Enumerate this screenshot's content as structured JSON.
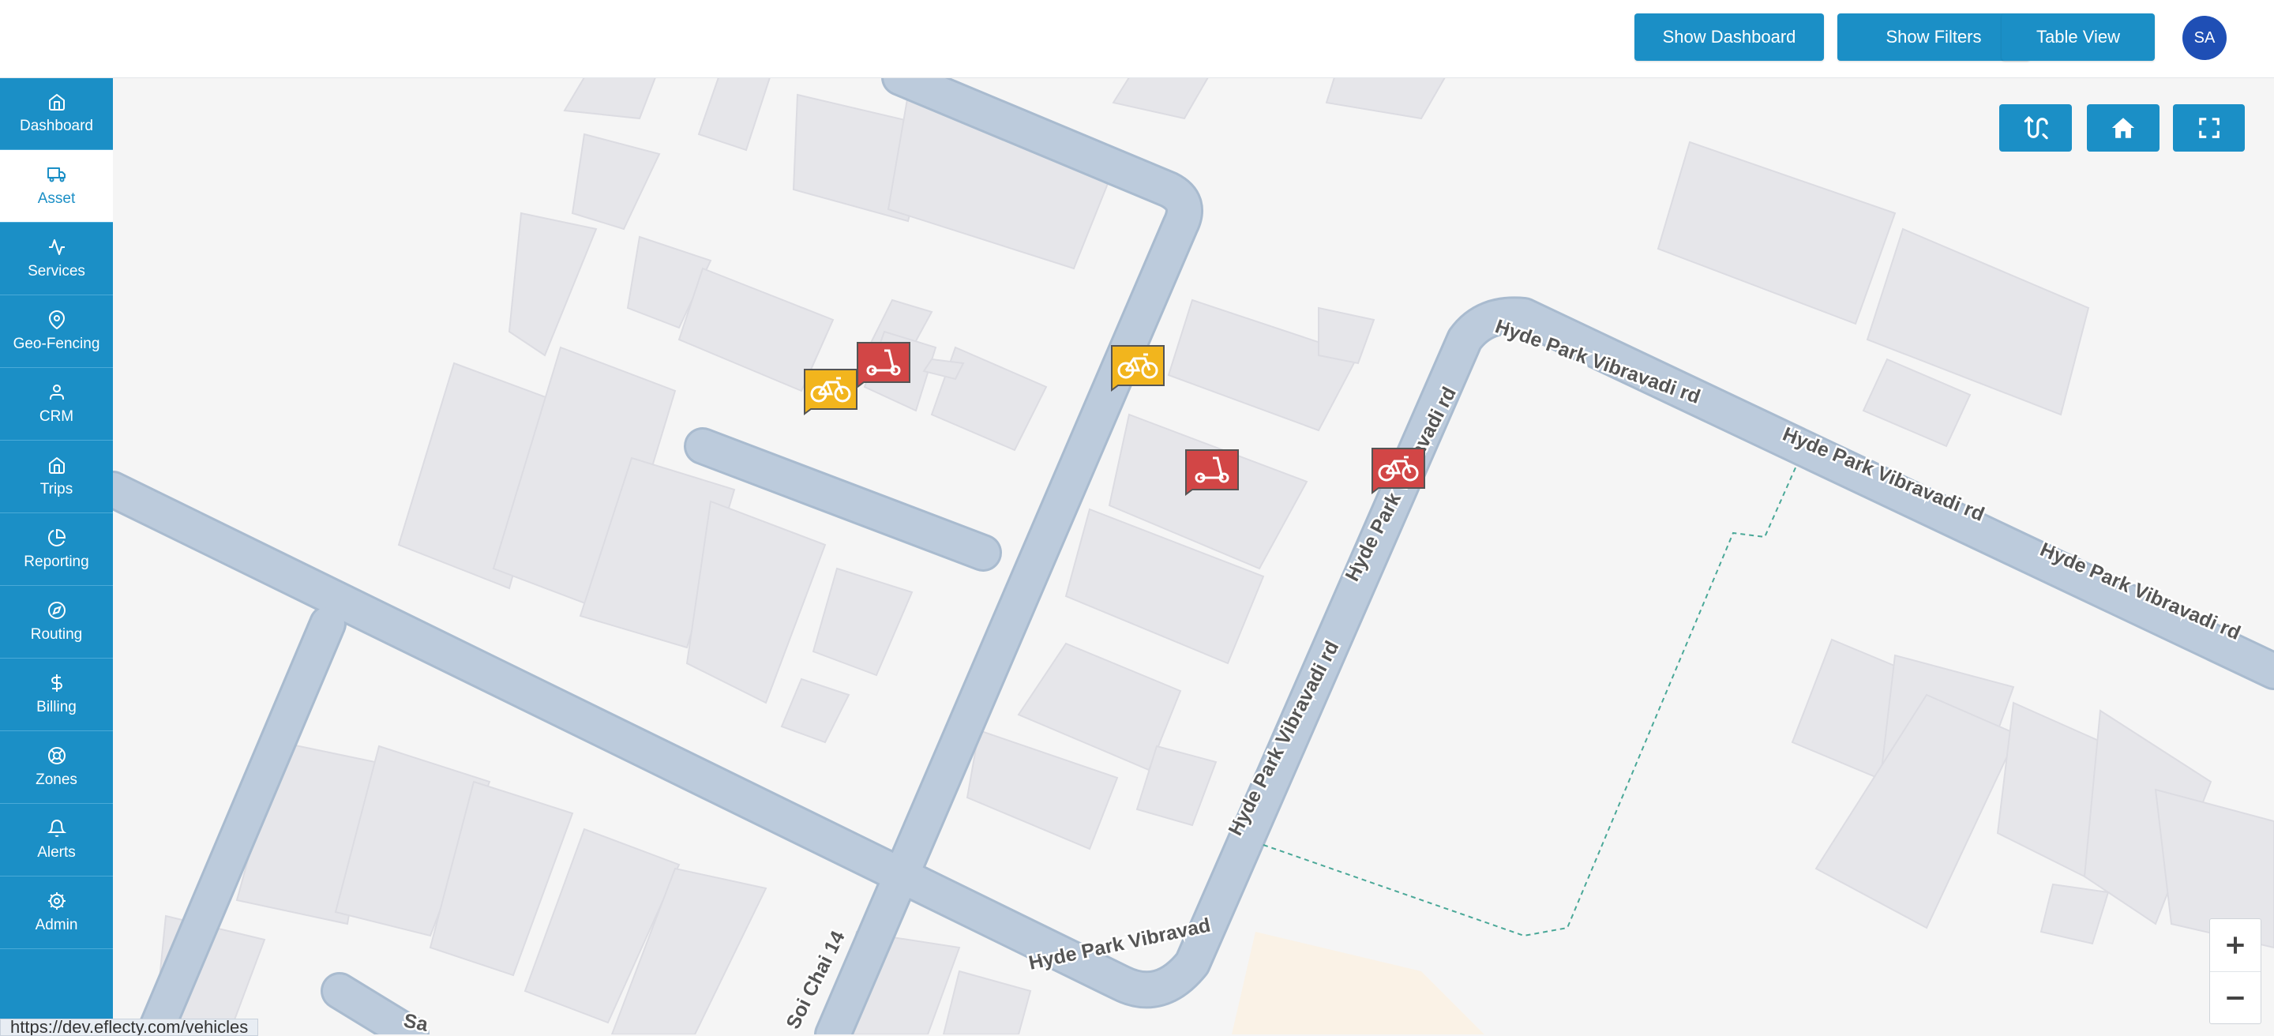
{
  "header": {
    "buttons": {
      "dashboard": "Show Dashboard",
      "filters": "Show Filters",
      "table": "Table View"
    },
    "avatar_initials": "SA"
  },
  "sidebar": {
    "items": [
      {
        "label": "Dashboard",
        "icon": "home-icon"
      },
      {
        "label": "Asset",
        "icon": "truck-icon",
        "active": true
      },
      {
        "label": "Services",
        "icon": "activity-icon"
      },
      {
        "label": "Geo-Fencing",
        "icon": "map-pin-icon"
      },
      {
        "label": "CRM",
        "icon": "user-icon"
      },
      {
        "label": "Trips",
        "icon": "home-icon"
      },
      {
        "label": "Reporting",
        "icon": "pie-chart-icon"
      },
      {
        "label": "Routing",
        "icon": "compass-icon"
      },
      {
        "label": "Billing",
        "icon": "dollar-icon"
      },
      {
        "label": "Zones",
        "icon": "life-buoy-icon"
      },
      {
        "label": "Alerts",
        "icon": "bell-icon"
      },
      {
        "label": "Admin",
        "icon": "settings-icon"
      }
    ]
  },
  "map": {
    "controls": [
      "route-icon",
      "home-icon",
      "fullscreen-icon"
    ],
    "zoom_in": "+",
    "zoom_out": "−",
    "street_labels": {
      "vibravadi": "Hyde Park Vibravadi rd",
      "soi_chai": "Soi Chai 14",
      "partial": "Sa"
    },
    "markers": [
      {
        "type": "bicycle",
        "color": "#f2b51d"
      },
      {
        "type": "scooter",
        "color": "#d24646"
      },
      {
        "type": "bicycle",
        "color": "#f2b51d"
      },
      {
        "type": "scooter",
        "color": "#d24646"
      },
      {
        "type": "bicycle",
        "color": "#d24646"
      }
    ],
    "colors": {
      "road": "#bccbdc",
      "building": "#e6e6ea",
      "ground": "#f5f5f5",
      "accent": "#1b8fc6"
    }
  },
  "status_bar": {
    "url": "https://dev.eflecty.com/vehicles"
  }
}
